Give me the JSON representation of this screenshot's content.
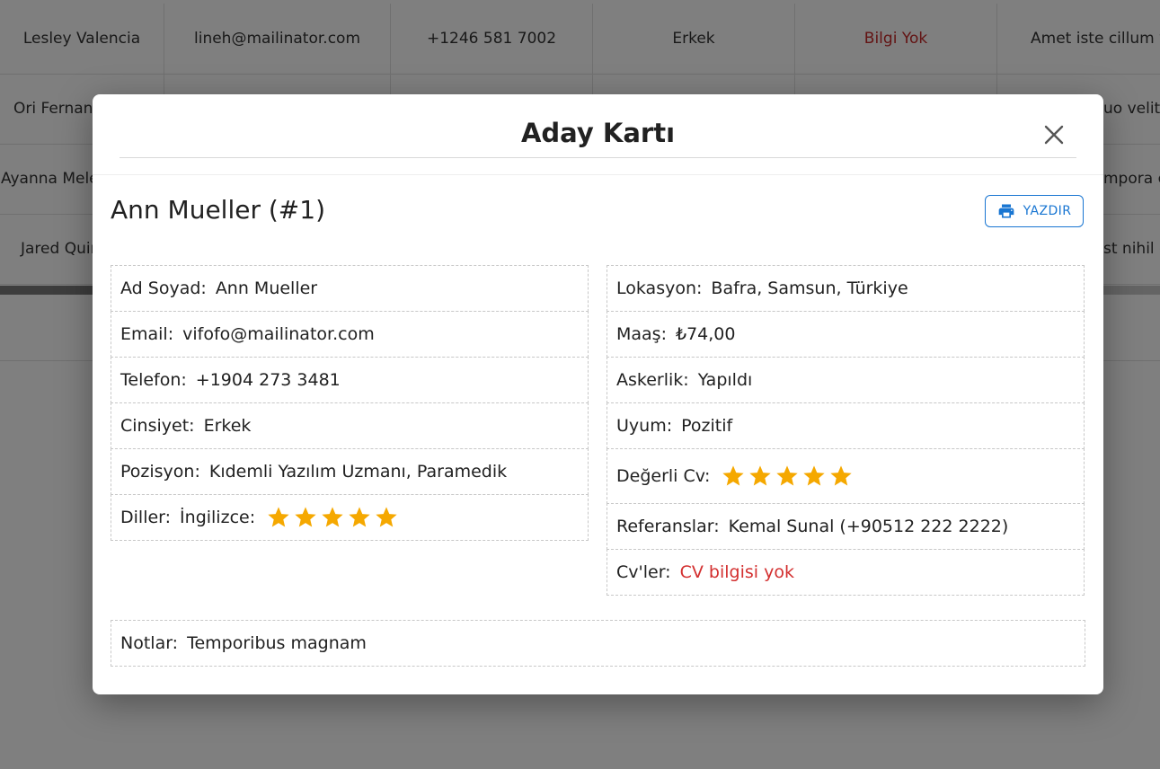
{
  "background_table": {
    "rows": [
      {
        "name": "Lesley Valencia",
        "email": "lineh@mailinator.com",
        "phone": "+1246 581 7002",
        "gender": "Erkek",
        "status": "Bilgi Yok",
        "note": "Amet iste cillum ve"
      },
      {
        "name": "Ori Fernand",
        "note": "uo velit e"
      },
      {
        "name": "Ayanna Mele",
        "note": "mpora et"
      },
      {
        "name": "Jared Quin",
        "note": "st nihil q"
      }
    ]
  },
  "modal": {
    "title": "Aday Kartı",
    "candidate_heading": "Ann Mueller (#1)",
    "print_label": "YAZDIR",
    "left_fields": [
      {
        "label": "Ad Soyad:",
        "value": "Ann Mueller"
      },
      {
        "label": "Email:",
        "value": "vifofo@mailinator.com"
      },
      {
        "label": "Telefon:",
        "value": "+1904 273 3481"
      },
      {
        "label": "Cinsiyet:",
        "value": "Erkek"
      },
      {
        "label": "Pozisyon:",
        "value": "Kıdemli Yazılım Uzmanı, Paramedik"
      }
    ],
    "languages": {
      "label": "Diller:",
      "language": "İngilizce:",
      "rating": 5,
      "max": 5
    },
    "right_fields": [
      {
        "label": "Lokasyon:",
        "value": "Bafra, Samsun, Türkiye"
      },
      {
        "label": "Maaş:",
        "value": "₺74,00"
      },
      {
        "label": "Askerlik:",
        "value": "Yapıldı"
      },
      {
        "label": "Uyum:",
        "value": "Pozitif"
      }
    ],
    "valuable_cv": {
      "label": "Değerli Cv:",
      "rating": 5,
      "max": 5
    },
    "references": {
      "label": "Referanslar:",
      "value": "Kemal Sunal (+90512 222 2222)"
    },
    "cvs": {
      "label": "Cv'ler:",
      "value": "CV bilgisi yok"
    },
    "notes": {
      "label": "Notlar:",
      "value": "Temporibus magnam"
    }
  },
  "colors": {
    "accent": "#1976d2",
    "star": "#f5a800",
    "warning_red": "#d32f2f",
    "border": "#c8c8c8"
  },
  "icons": {
    "close": "close-icon",
    "print": "printer-icon",
    "star": "star-icon"
  }
}
